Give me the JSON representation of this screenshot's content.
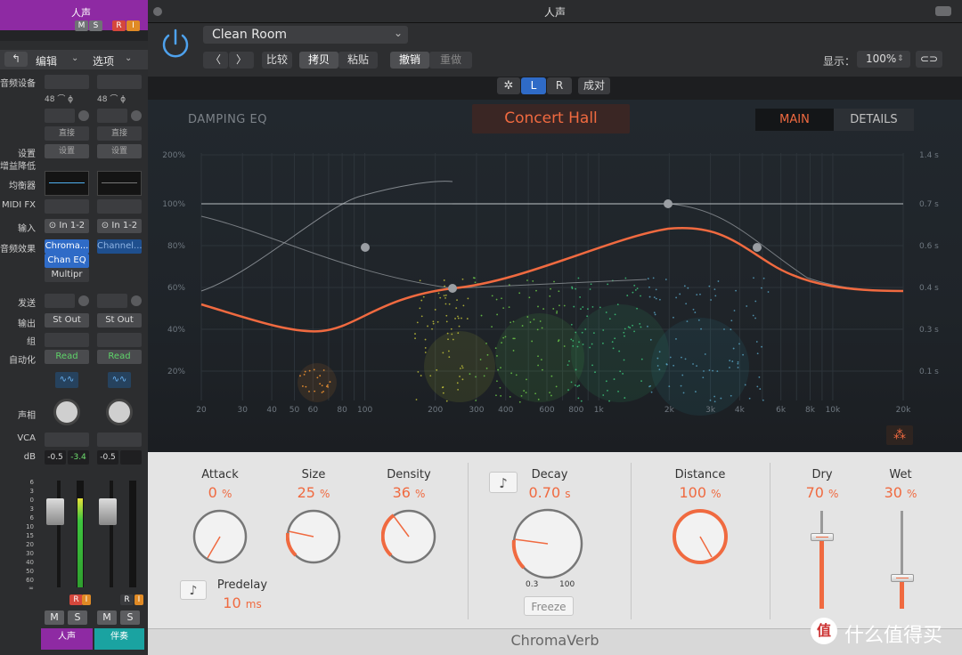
{
  "mixer": {
    "track1": {
      "name": "人声",
      "m": "M",
      "s": "S",
      "r": "R",
      "i": "I"
    },
    "menu": {
      "edit": "编辑",
      "options": "选项"
    },
    "labels": [
      "音频设备",
      "设置",
      "增益降低",
      "均衡器",
      "MIDI FX",
      "输入",
      "音频效果",
      "发送",
      "输出",
      "组",
      "自动化",
      "声相",
      "VCA",
      "dB"
    ],
    "ch1": {
      "rate": "48",
      "link": "直接",
      "settings": "设置",
      "input": "In 1-2",
      "fx": [
        "Chroma...",
        "Chan EQ",
        "Multipr"
      ],
      "output": "St Out",
      "auto": "Read",
      "db1": "-0.5",
      "db2": "-3.4",
      "r": "R",
      "i": "I",
      "m": "M",
      "s": "S",
      "name": "人声"
    },
    "ch2": {
      "rate": "48",
      "link": "直接",
      "settings": "设置",
      "input": "In 1-2",
      "fx": [
        "Channel..."
      ],
      "output": "St Out",
      "auto": "Read",
      "db1": "-0.5",
      "r": "R",
      "i": "I",
      "m": "M",
      "s": "S",
      "name": "伴奏"
    },
    "scale": [
      "6",
      "3",
      "0",
      "3",
      "6",
      "10",
      "15",
      "20",
      "30",
      "40",
      "50",
      "60"
    ],
    "scale_bottom": "∞"
  },
  "plugin": {
    "title": "人声",
    "preset": "Clean Room",
    "compare": "比较",
    "copy": "拷贝",
    "paste": "粘贴",
    "undo": "撤销",
    "redo": "重做",
    "display_label": "显示：",
    "zoom": "100%",
    "channel_l": "L",
    "channel_r": "R",
    "pair": "成对",
    "eq_label": "DAMPING EQ",
    "space": "Concert Hall",
    "tab_main": "MAIN",
    "tab_details": "DETAILS",
    "footer": "ChromaVerb",
    "colors": {
      "accent": "#f06a40",
      "tab_active": "#f06a40"
    }
  },
  "graph": {
    "y_left": [
      "200%",
      "100%",
      "80%",
      "60%",
      "40%",
      "20%"
    ],
    "y_right": [
      "1.4 s",
      "0.7 s",
      "0.6 s",
      "0.4 s",
      "0.3 s",
      "0.1 s"
    ],
    "x": [
      "20",
      "30",
      "40",
      "50",
      "60",
      "80",
      "100",
      "200",
      "300",
      "400",
      "600",
      "800",
      "1k",
      "2k",
      "3k",
      "4k",
      "6k",
      "8k",
      "10k",
      "20k"
    ]
  },
  "params": {
    "attack": {
      "label": "Attack",
      "value": "0",
      "unit": "%"
    },
    "size": {
      "label": "Size",
      "value": "25",
      "unit": "%"
    },
    "density": {
      "label": "Density",
      "value": "36",
      "unit": "%"
    },
    "predelay": {
      "label": "Predelay",
      "value": "10",
      "unit": "ms"
    },
    "decay": {
      "label": "Decay",
      "value": "0.70",
      "unit": "s",
      "min": "0.3",
      "max": "100"
    },
    "freeze": "Freeze",
    "distance": {
      "label": "Distance",
      "value": "100",
      "unit": "%"
    },
    "dry": {
      "label": "Dry",
      "value": "70",
      "unit": "%"
    },
    "wet": {
      "label": "Wet",
      "value": "30",
      "unit": "%"
    }
  },
  "watermark": {
    "text": "什么值得买",
    "icon": "值"
  }
}
